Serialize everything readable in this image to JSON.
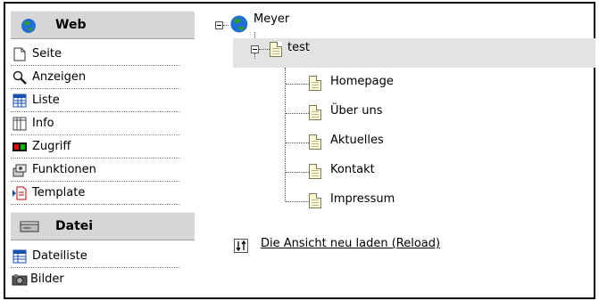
{
  "sidebar": {
    "web": {
      "title": "Web",
      "items": [
        {
          "label": "Seite",
          "icon": "page-icon"
        },
        {
          "label": "Anzeigen",
          "icon": "magnifier-icon"
        },
        {
          "label": "Liste",
          "icon": "list-icon"
        },
        {
          "label": "Info",
          "icon": "info-icon"
        },
        {
          "label": "Zugriff",
          "icon": "access-icon"
        },
        {
          "label": "Funktionen",
          "icon": "functions-icon"
        },
        {
          "label": "Template",
          "icon": "template-icon"
        }
      ]
    },
    "datei": {
      "title": "Datei",
      "items": [
        {
          "label": "Dateiliste",
          "icon": "filelist-icon"
        },
        {
          "label": "Bilder",
          "icon": "images-icon"
        }
      ]
    }
  },
  "tree": {
    "root": {
      "label": "Meyer"
    },
    "child": {
      "label": "test",
      "selected": true
    },
    "pages": [
      "Homepage",
      "Über uns",
      "Aktuelles",
      "Kontakt",
      "Impressum"
    ]
  },
  "reload_link": "Die Ansicht neu laden (Reload)",
  "colors": {
    "header_bg": "#d6d6d6",
    "selected_bg": "#e3e3e3",
    "page_icon": "#fffbd6"
  }
}
